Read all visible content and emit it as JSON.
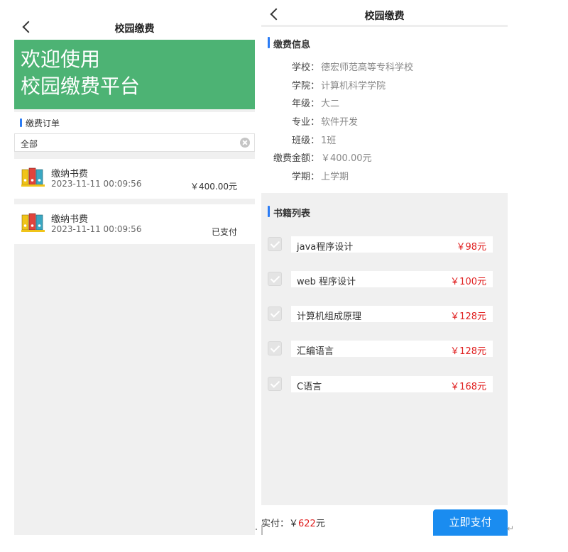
{
  "left": {
    "nav_title": "校园缴费",
    "banner_line1": "欢迎使用",
    "banner_line2": "校园缴费平台",
    "section_title": "缴费订单",
    "filter_value": "全部",
    "orders": [
      {
        "name": "缴纳书费",
        "time": "2023-11-11 00:09:56",
        "right": "￥400.00元"
      },
      {
        "name": "缴纳书费",
        "time": "2023-11-11 00:09:56",
        "right": "已支付"
      }
    ]
  },
  "right": {
    "nav_title": "校园缴费",
    "info_title": "缴费信息",
    "info": [
      {
        "label": "学校：",
        "value": "德宏师范高等专科学校"
      },
      {
        "label": "学院：",
        "value": "计算机科学学院"
      },
      {
        "label": "年级：",
        "value": "大二"
      },
      {
        "label": "专业：",
        "value": "软件开发"
      },
      {
        "label": "班级：",
        "value": "1班"
      },
      {
        "label": "缴费金额：",
        "value": "￥400.00元"
      },
      {
        "label": "学期：",
        "value": "上学期"
      }
    ],
    "books_title": "书籍列表",
    "books": [
      {
        "title": "java程序设计",
        "price": "￥98元"
      },
      {
        "title": "web 程序设计",
        "price": "￥100元"
      },
      {
        "title": "计算机组成原理",
        "price": "￥128元"
      },
      {
        "title": "汇编语言",
        "price": "￥128元"
      },
      {
        "title": "C语言",
        "price": "￥168元"
      }
    ],
    "pay_label": "实付：￥",
    "pay_amount": "622",
    "pay_unit": "元",
    "pay_button": "立即支付"
  },
  "colors": {
    "banner": "#4db374",
    "accent": "#2b7cf5",
    "pay_button": "#1a8cf0",
    "price_red": "#e02020"
  },
  "icons": {
    "back": "chevron-left-icon",
    "clear": "clear-circle-icon",
    "order": "binder-folders-icon",
    "check": "checkbox-checked-icon"
  }
}
